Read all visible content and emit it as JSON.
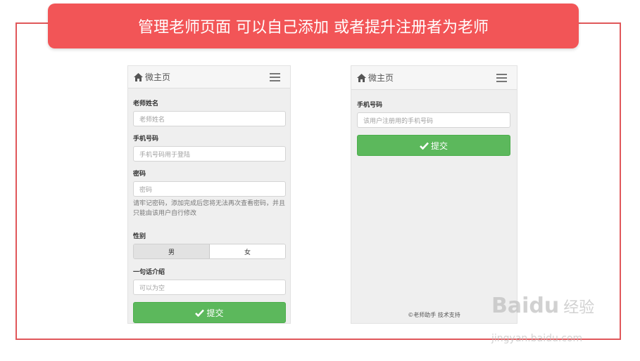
{
  "banner": {
    "text": "管理老师页面 可以自己添加 或者提升注册者为老师"
  },
  "left_phone": {
    "brand": "微主页",
    "fields": {
      "name_label": "老师姓名",
      "name_placeholder": "老师姓名",
      "phone_label": "手机号码",
      "phone_placeholder": "手机号码用于登陆",
      "password_label": "密码",
      "password_placeholder": "密码",
      "password_help": "请牢记密码，添加完成后您将无法再次查看密码，并且只能由该用户自行修改",
      "gender_label": "性别",
      "gender_male": "男",
      "gender_female": "女",
      "intro_label": "一句话介绍",
      "intro_placeholder": "可以为空"
    },
    "submit_label": "提交"
  },
  "right_phone": {
    "brand": "微主页",
    "phone_label": "手机号码",
    "phone_placeholder": "该用户注册用的手机号码",
    "submit_label": "提交",
    "footer": "©老师助手 技术支持"
  },
  "watermark": {
    "brand": "Baidu",
    "cn": "经验",
    "url": "jingyan.baidu.com"
  },
  "colors": {
    "banner": "#f25557",
    "frame": "#e0575a",
    "submit": "#5cb85c"
  },
  "icons": [
    "home-icon",
    "hamburger-menu-icon",
    "checkmark-icon"
  ]
}
